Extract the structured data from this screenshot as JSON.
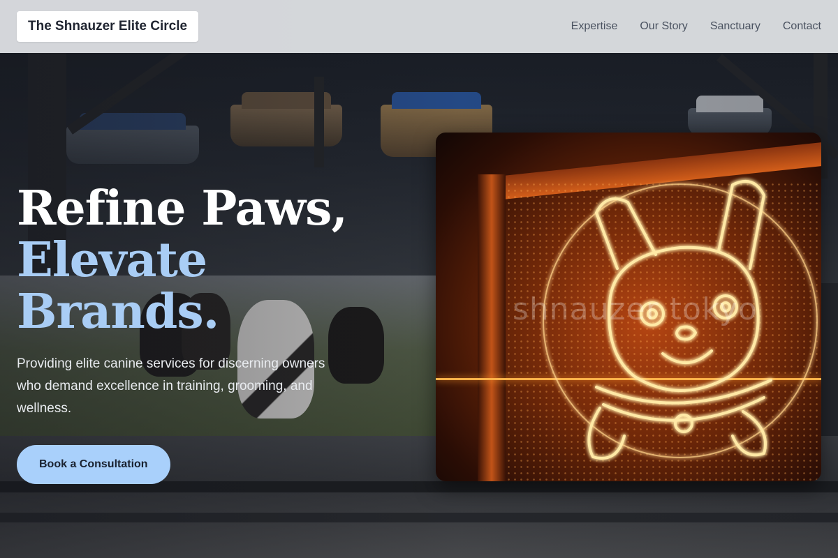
{
  "header": {
    "brand": "The Shnauzer Elite Circle",
    "nav": [
      {
        "label": "Expertise"
      },
      {
        "label": "Our Story"
      },
      {
        "label": "Sanctuary"
      },
      {
        "label": "Contact"
      }
    ]
  },
  "hero": {
    "headline_line1": "Refine Paws,",
    "headline_line2": "Elevate Brands.",
    "subtitle": "Providing elite canine services for discerning owners who demand excellence in training, grooming, and wellness.",
    "cta_label": "Book a Consultation"
  },
  "image": {
    "watermark": "shnauzer tokyo",
    "subject": "neon-dog-sign"
  },
  "colors": {
    "accent": "#a9cdf5",
    "cta_bg": "#a9d0fb",
    "header_bg": "#dee0e4"
  }
}
